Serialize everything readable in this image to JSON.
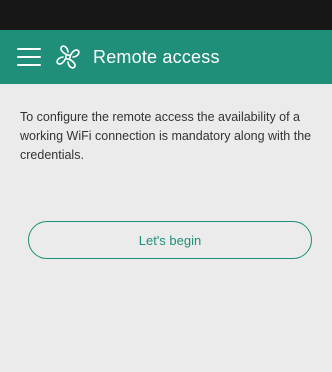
{
  "app_bar": {
    "title": "Remote access",
    "menu_icon": "hamburger-menu-icon",
    "logo_icon": "fan-logo-icon",
    "background": "#1f8f79"
  },
  "status_bar": {
    "background": "#171717"
  },
  "main": {
    "description": "To configure the remote access the availability of a working WiFi connection is mandatory along with the credentials.",
    "begin_button_label": "Let's begin"
  },
  "colors": {
    "accent": "#1f8f79",
    "page_background": "#ebebeb",
    "text": "#333333"
  }
}
